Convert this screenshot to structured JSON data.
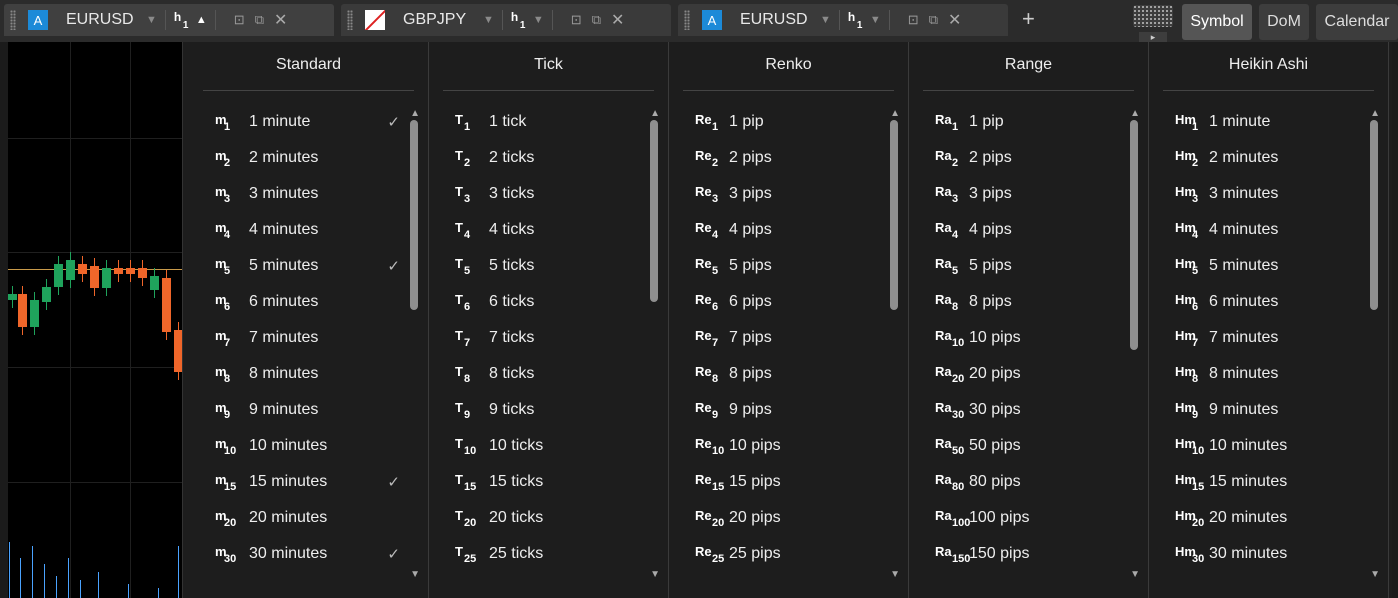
{
  "tabs": [
    {
      "symbol": "EURUSD",
      "badge": "A",
      "tf": "h",
      "tf_sub": "1",
      "caret": "▼",
      "tf_caret": "▲"
    },
    {
      "symbol": "GBPJPY",
      "badge": "",
      "tf": "h",
      "tf_sub": "1",
      "caret": "▼",
      "tf_caret": "▼"
    },
    {
      "symbol": "EURUSD",
      "badge": "A",
      "tf": "h",
      "tf_sub": "1",
      "caret": "▼",
      "tf_caret": "▼"
    }
  ],
  "add_tab": "+",
  "right_tabs": {
    "symbol": "Symbol",
    "dom": "DoM",
    "calendar": "Calendar"
  },
  "colors": {
    "bull": "#1fa35c",
    "bear": "#f0662a",
    "price_line": "#c89a4a",
    "accent": "#1c8ad8"
  },
  "columns": [
    {
      "title": "Standard",
      "prefix": "m",
      "items": [
        {
          "sub": "1",
          "label": "1 minute",
          "checked": true
        },
        {
          "sub": "2",
          "label": "2 minutes",
          "checked": false
        },
        {
          "sub": "3",
          "label": "3 minutes",
          "checked": false
        },
        {
          "sub": "4",
          "label": "4 minutes",
          "checked": false
        },
        {
          "sub": "5",
          "label": "5 minutes",
          "checked": true
        },
        {
          "sub": "6",
          "label": "6 minutes",
          "checked": false
        },
        {
          "sub": "7",
          "label": "7 minutes",
          "checked": false
        },
        {
          "sub": "8",
          "label": "8 minutes",
          "checked": false
        },
        {
          "sub": "9",
          "label": "9 minutes",
          "checked": false
        },
        {
          "sub": "10",
          "label": "10 minutes",
          "checked": false
        },
        {
          "sub": "15",
          "label": "15 minutes",
          "checked": true
        },
        {
          "sub": "20",
          "label": "20 minutes",
          "checked": false
        },
        {
          "sub": "30",
          "label": "30 minutes",
          "checked": true
        }
      ]
    },
    {
      "title": "Tick",
      "prefix": "T",
      "items": [
        {
          "sub": "1",
          "label": "1 tick",
          "checked": false
        },
        {
          "sub": "2",
          "label": "2 ticks",
          "checked": false
        },
        {
          "sub": "3",
          "label": "3 ticks",
          "checked": false
        },
        {
          "sub": "4",
          "label": "4 ticks",
          "checked": false
        },
        {
          "sub": "5",
          "label": "5 ticks",
          "checked": false
        },
        {
          "sub": "6",
          "label": "6 ticks",
          "checked": false
        },
        {
          "sub": "7",
          "label": "7 ticks",
          "checked": false
        },
        {
          "sub": "8",
          "label": "8 ticks",
          "checked": false
        },
        {
          "sub": "9",
          "label": "9 ticks",
          "checked": false
        },
        {
          "sub": "10",
          "label": "10 ticks",
          "checked": false
        },
        {
          "sub": "15",
          "label": "15 ticks",
          "checked": false
        },
        {
          "sub": "20",
          "label": "20 ticks",
          "checked": false
        },
        {
          "sub": "25",
          "label": "25 ticks",
          "checked": false
        }
      ]
    },
    {
      "title": "Renko",
      "prefix": "Re",
      "items": [
        {
          "sub": "1",
          "label": "1 pip",
          "checked": false
        },
        {
          "sub": "2",
          "label": "2 pips",
          "checked": false
        },
        {
          "sub": "3",
          "label": "3 pips",
          "checked": false
        },
        {
          "sub": "4",
          "label": "4 pips",
          "checked": false
        },
        {
          "sub": "5",
          "label": "5 pips",
          "checked": false
        },
        {
          "sub": "6",
          "label": "6 pips",
          "checked": false
        },
        {
          "sub": "7",
          "label": "7 pips",
          "checked": false
        },
        {
          "sub": "8",
          "label": "8 pips",
          "checked": false
        },
        {
          "sub": "9",
          "label": "9 pips",
          "checked": false
        },
        {
          "sub": "10",
          "label": "10 pips",
          "checked": false
        },
        {
          "sub": "15",
          "label": "15 pips",
          "checked": false
        },
        {
          "sub": "20",
          "label": "20 pips",
          "checked": false
        },
        {
          "sub": "25",
          "label": "25 pips",
          "checked": false
        }
      ]
    },
    {
      "title": "Range",
      "prefix": "Ra",
      "items": [
        {
          "sub": "1",
          "label": "1 pip",
          "checked": false
        },
        {
          "sub": "2",
          "label": "2 pips",
          "checked": false
        },
        {
          "sub": "3",
          "label": "3 pips",
          "checked": false
        },
        {
          "sub": "4",
          "label": "4 pips",
          "checked": false
        },
        {
          "sub": "5",
          "label": "5 pips",
          "checked": false
        },
        {
          "sub": "8",
          "label": "8 pips",
          "checked": false
        },
        {
          "sub": "10",
          "label": "10 pips",
          "checked": false
        },
        {
          "sub": "20",
          "label": "20 pips",
          "checked": false
        },
        {
          "sub": "30",
          "label": "30 pips",
          "checked": false
        },
        {
          "sub": "50",
          "label": "50 pips",
          "checked": false
        },
        {
          "sub": "80",
          "label": "80 pips",
          "checked": false
        },
        {
          "sub": "100",
          "label": "100 pips",
          "checked": false
        },
        {
          "sub": "150",
          "label": "150 pips",
          "checked": false
        }
      ]
    },
    {
      "title": "Heikin Ashi",
      "prefix": "Hm",
      "items": [
        {
          "sub": "1",
          "label": "1 minute",
          "checked": false
        },
        {
          "sub": "2",
          "label": "2 minutes",
          "checked": false
        },
        {
          "sub": "3",
          "label": "3 minutes",
          "checked": false
        },
        {
          "sub": "4",
          "label": "4 minutes",
          "checked": false
        },
        {
          "sub": "5",
          "label": "5 minutes",
          "checked": false
        },
        {
          "sub": "6",
          "label": "6 minutes",
          "checked": false
        },
        {
          "sub": "7",
          "label": "7 minutes",
          "checked": false
        },
        {
          "sub": "8",
          "label": "8 minutes",
          "checked": false
        },
        {
          "sub": "9",
          "label": "9 minutes",
          "checked": false
        },
        {
          "sub": "10",
          "label": "10 minutes",
          "checked": false
        },
        {
          "sub": "15",
          "label": "15 minutes",
          "checked": false
        },
        {
          "sub": "20",
          "label": "20 minutes",
          "checked": false
        },
        {
          "sub": "30",
          "label": "30 minutes",
          "checked": false
        }
      ]
    }
  ],
  "check_glyph": "✓"
}
